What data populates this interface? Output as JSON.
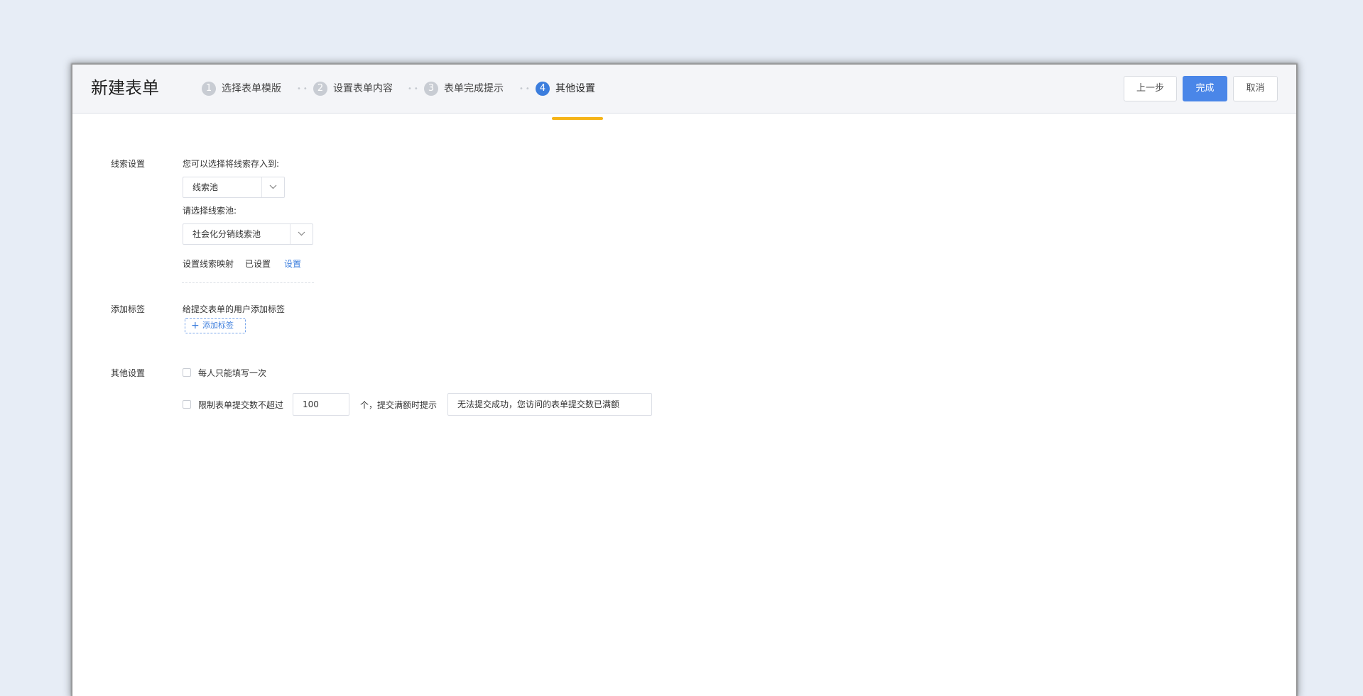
{
  "header": {
    "title": "新建表单",
    "steps": [
      {
        "num": "1",
        "label": "选择表单模版"
      },
      {
        "num": "2",
        "label": "设置表单内容"
      },
      {
        "num": "3",
        "label": "表单完成提示"
      },
      {
        "num": "4",
        "label": "其他设置"
      }
    ],
    "step_separator": "••",
    "active_step": 4,
    "buttons": {
      "prev": "上一步",
      "finish": "完成",
      "cancel": "取消"
    }
  },
  "lead_settings": {
    "section_label": "线索设置",
    "store_prompt": "您可以选择将线索存入到:",
    "store_select_value": "线索池",
    "pool_prompt": "请选择线索池:",
    "pool_select_value": "社会化分销线索池",
    "mapping_label": "设置线索映射",
    "mapping_status": "已设置",
    "mapping_link": "设置"
  },
  "tags": {
    "section_label": "添加标签",
    "description": "给提交表单的用户添加标签",
    "add_button_plus": "+",
    "add_button_label": "添加标签"
  },
  "other_settings": {
    "section_label": "其他设置",
    "once_per_person_label": "每人只能填写一次",
    "once_per_person_checked": false,
    "limit_label": "限制表单提交数不超过",
    "limit_checked": false,
    "limit_value": "100",
    "limit_suffix": "个，提交满额时提示",
    "full_message": "无法提交成功，您访问的表单提交数已满额"
  },
  "colors": {
    "accent": "#4a86e8",
    "active_step": "#3b7ddd",
    "step_underline": "#f5b418",
    "background": "#e7edf6"
  }
}
